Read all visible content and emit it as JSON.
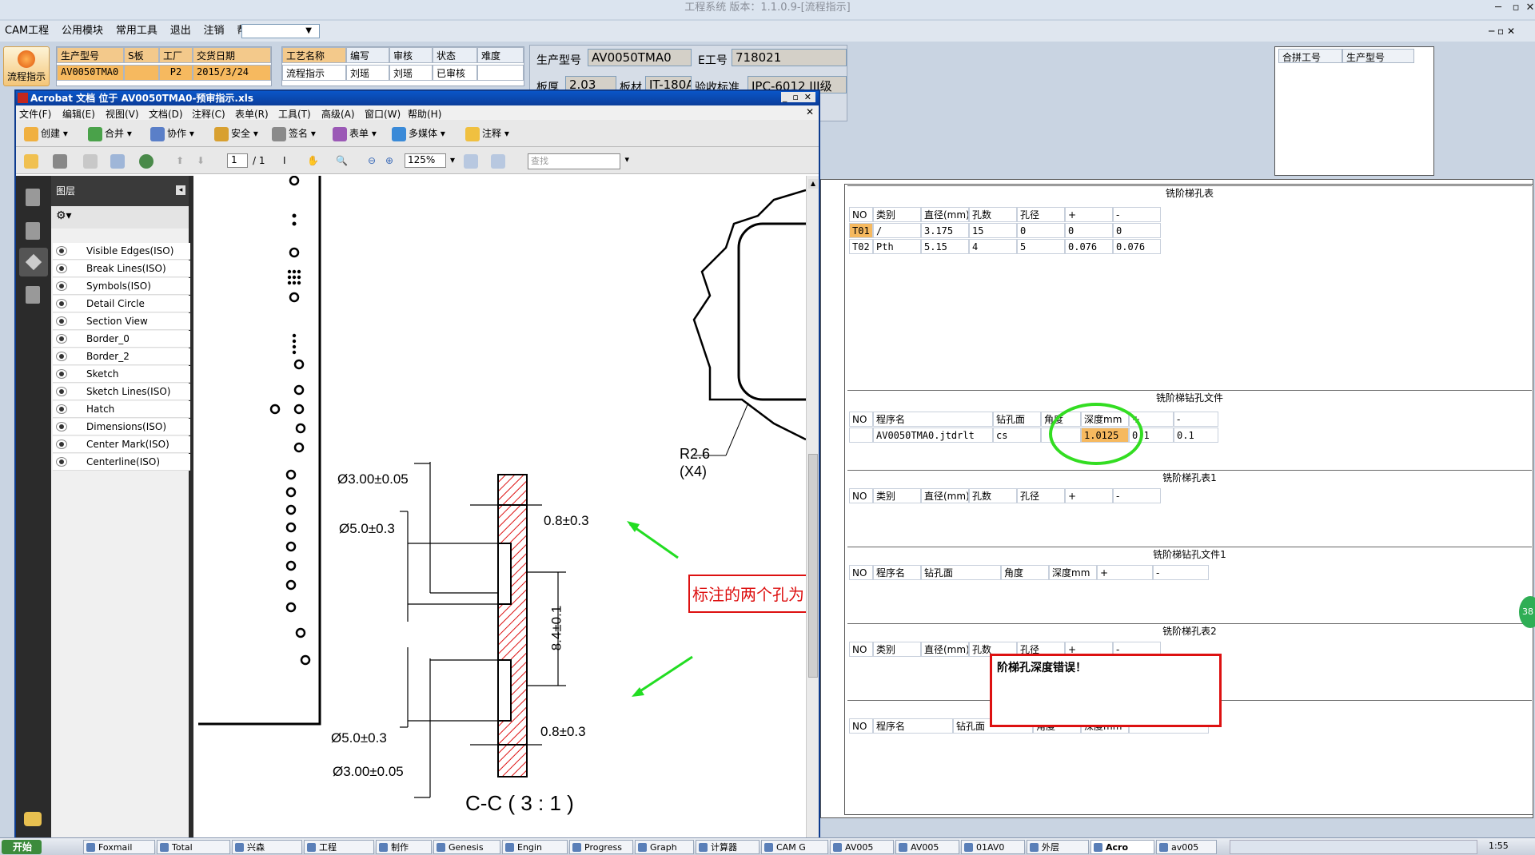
{
  "window": {
    "title": "工程系统 版本：1.1.0.9-[流程指示]",
    "controls": [
      "─",
      "▫",
      "✕"
    ]
  },
  "menu": {
    "items": [
      "CAM工程",
      "公用模块",
      "常用工具",
      "退出",
      "注销",
      "帮助"
    ],
    "dropdown_value": ""
  },
  "left_button": {
    "label": "流程指示"
  },
  "info_table": {
    "headers": [
      "生产型号",
      "S板",
      "工厂",
      "交货日期"
    ],
    "row": [
      "AV0050TMA0",
      "",
      "P2",
      "2015/3/24"
    ]
  },
  "process_table": {
    "headers": [
      "工艺名称",
      "编写",
      "审核",
      "状态",
      "难度"
    ],
    "row": [
      "流程指示",
      "刘瑶",
      "刘瑶",
      "已审核",
      ""
    ]
  },
  "form": {
    "prod_model_label": "生产型号",
    "prod_model": "AV0050TMA0",
    "ework_label": "E工号",
    "ework": "718021",
    "thick_label": "板厚",
    "thick": "2.03",
    "material_label": "板材",
    "material": "IT-180A",
    "standard_label": "验收标准",
    "standard": "IPC-6012 III级"
  },
  "merge_table": {
    "headers": [
      "合拼工号",
      "生产型号"
    ]
  },
  "acrobat": {
    "title": "Acrobat 文档 位于 AV0050TMA0-预审指示.xls",
    "menu": [
      "文件(F)",
      "编辑(E)",
      "视图(V)",
      "文档(D)",
      "注释(C)",
      "表单(R)",
      "工具(T)",
      "高级(A)",
      "窗口(W)",
      "帮助(H)"
    ],
    "toolbar1": [
      "创建",
      "合并",
      "协作",
      "安全",
      "签名",
      "表单",
      "多媒体",
      "注释"
    ],
    "page_current": "1",
    "page_total": "/ 1",
    "zoom": "125%",
    "find_placeholder": "查找",
    "layers_title": "图层",
    "layers": [
      "Visible Edges(ISO)",
      "Break Lines(ISO)",
      "Symbols(ISO)",
      "Detail Circle Lines(ISO)",
      "Section View Lines(ISO)",
      "Border_0",
      "Border_2",
      "Sketch Geometry(ISO)",
      "Sketch Lines(ISO)",
      "Hatch",
      "Dimensions(ISO)",
      "Center Mark(ISO)",
      "Centerline(ISO)"
    ]
  },
  "drawing": {
    "dim1": "Ø3.00±0.05",
    "dim2": "Ø5.0±0.3",
    "dim3": "0.8±0.3",
    "dim4": "8.4±0.1",
    "dim5": "Ø5.0±0.3",
    "dim6": "0.8±0.3",
    "dim7": "Ø3.00±0.05",
    "radius": "R2.6",
    "radius_count": "(X4)",
    "section": "C-C ( 3 : 1 )",
    "note": "标注的两个孔为"
  },
  "grids": {
    "t1": {
      "caption": "铣阶梯孔表",
      "headers": [
        "NO",
        "类别",
        "直径(mm)",
        "孔数",
        "孔径",
        "+",
        "-"
      ],
      "rows": [
        [
          "T01",
          "/",
          "3.175",
          "15",
          "0",
          "0",
          "0"
        ],
        [
          "T02",
          "Pth",
          "5.15",
          "4",
          "5",
          "0.076",
          "0.076"
        ]
      ]
    },
    "t2": {
      "caption": "铣阶梯钻孔文件",
      "headers": [
        "NO",
        "程序名",
        "钻孔面",
        "角度",
        "深度mm",
        "+",
        "-"
      ],
      "rows": [
        [
          "",
          "AV0050TMA0.jtdrlt",
          "cs",
          "",
          "1.0125",
          "0.1",
          "0.1"
        ]
      ]
    },
    "t3": {
      "caption": "铣阶梯孔表1",
      "headers": [
        "NO",
        "类别",
        "直径(mm)",
        "孔数",
        "孔径",
        "+",
        "-"
      ]
    },
    "t4": {
      "caption": "铣阶梯钻孔文件1",
      "headers": [
        "NO",
        "程序名",
        "钻孔面",
        "角度",
        "深度mm",
        "+",
        "-"
      ]
    },
    "t5": {
      "caption": "铣阶梯孔表2",
      "headers": [
        "NO",
        "类别",
        "直径(mm)",
        "孔数",
        "孔径",
        "+",
        "-"
      ]
    },
    "t6": {
      "headers": [
        "NO",
        "程序名",
        "钻孔面",
        "角度",
        "深度mm"
      ]
    }
  },
  "error_box": {
    "text": "阶梯孔深度错误！"
  },
  "side_badge": "38",
  "taskbar": {
    "start": "开始",
    "items": [
      "Foxmail",
      "Total",
      "兴森",
      "工程",
      "制作",
      "Genesis",
      "Engin",
      "Progress",
      "Graph",
      "计算器",
      "CAM G",
      "AV005",
      "AV005",
      "01AV0",
      "外层",
      "Acro",
      "av005"
    ],
    "clock": "1:55"
  },
  "colors": {
    "accent": "#f3c98b",
    "selected": "#f6b95f",
    "highlight_circle": "#33dd22",
    "arrow": "#22dd22",
    "error_border": "#dd1111"
  }
}
